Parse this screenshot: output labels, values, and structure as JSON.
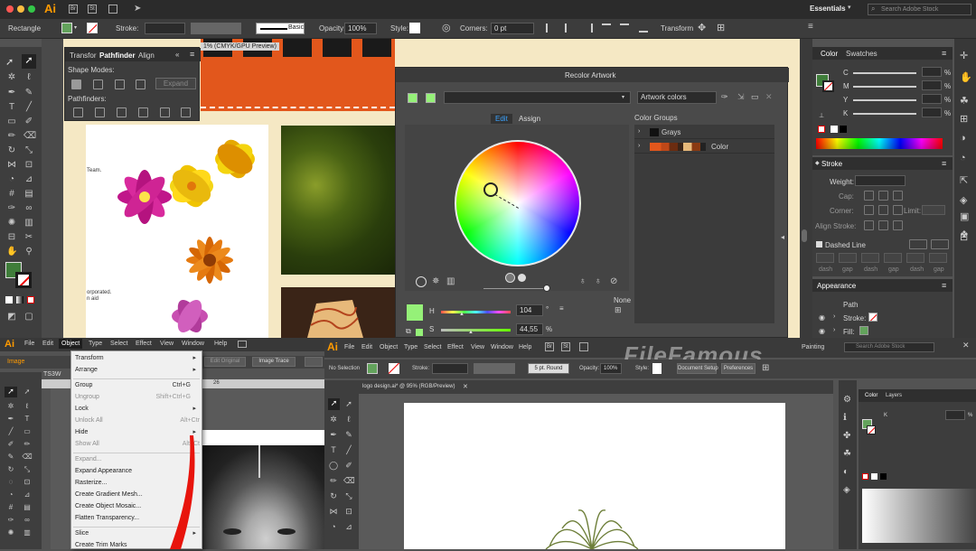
{
  "top_app": {
    "logo": "Ai",
    "workspace": "Essentials",
    "search_placeholder": "Search Adobe Stock",
    "control_bar": {
      "selection_label": "Rectangle",
      "stroke_label": "Stroke:",
      "brush_label": "Basic",
      "opacity_label": "Opacity:",
      "opacity_value": "100%",
      "style_label": "Style:",
      "corners_label": "Corners:",
      "corners_value": "0 pt",
      "transform_label": "Transform"
    },
    "doc_tab": "1% (CMYK/GPU Preview)",
    "pathfinder_panel": {
      "tabs": [
        "Transfor",
        "Pathfinder",
        "Align"
      ],
      "shape_modes_label": "Shape Modes:",
      "expand_label": "Expand",
      "pathfinders_label": "Pathfinders:"
    },
    "artboard_text": {
      "team": "Team.",
      "incorporated": "orporated.",
      "aid": "n aid"
    },
    "recolor": {
      "title": "Recolor Artwork",
      "artwork_colors": "Artwork colors",
      "tab_edit": "Edit",
      "tab_assign": "Assign",
      "color_groups_label": "Color Groups",
      "groups": [
        "Grays",
        "Color"
      ],
      "none_label": "None",
      "h_label": "H",
      "h_value": "104",
      "h_unit": "°",
      "s_label": "S",
      "s_value": "44,55",
      "s_unit": "%"
    },
    "color_panel": {
      "tabs": [
        "Color",
        "Swatches"
      ],
      "channels": [
        "C",
        "M",
        "Y",
        "K"
      ],
      "pct": "%"
    },
    "stroke_panel": {
      "title": "Stroke",
      "weight_label": "Weight:",
      "cap_label": "Cap:",
      "corner_label": "Corner:",
      "limit_label": "Limit:",
      "align_label": "Align Stroke:",
      "dashed_label": "Dashed Line",
      "dash_labels": [
        "dash",
        "gap",
        "dash",
        "gap",
        "dash",
        "gap"
      ]
    },
    "appearance_panel": {
      "title": "Appearance",
      "path_label": "Path",
      "stroke_label": "Stroke:",
      "fill_label": "Fill:"
    }
  },
  "bottom_left_app": {
    "logo": "Ai",
    "menu": [
      "File",
      "Edit",
      "Object",
      "Type",
      "Select",
      "Effect",
      "View",
      "Window",
      "Help"
    ],
    "image_label": "Image",
    "edit_original": "Edit Original",
    "image_trace": "Image Trace",
    "doc_tab": "TS3W",
    "ruler_mark": "26",
    "object_menu": [
      {
        "label": "Transform",
        "shortcut": "",
        "sub": true,
        "disabled": false
      },
      {
        "label": "Arrange",
        "shortcut": "",
        "sub": true,
        "disabled": false
      },
      {
        "label": "Group",
        "shortcut": "Ctrl+G",
        "sub": false,
        "disabled": false
      },
      {
        "label": "Ungroup",
        "shortcut": "Shift+Ctrl+G",
        "sub": false,
        "disabled": true
      },
      {
        "label": "Lock",
        "shortcut": "",
        "sub": true,
        "disabled": false
      },
      {
        "label": "Unlock All",
        "shortcut": "Alt+Ctr",
        "sub": false,
        "disabled": true
      },
      {
        "label": "Hide",
        "shortcut": "",
        "sub": true,
        "disabled": false
      },
      {
        "label": "Show All",
        "shortcut": "Alt+Ct",
        "sub": false,
        "disabled": true
      },
      {
        "label": "Expand...",
        "shortcut": "",
        "sub": false,
        "disabled": true
      },
      {
        "label": "Expand Appearance",
        "shortcut": "",
        "sub": false,
        "disabled": false
      },
      {
        "label": "Rasterize...",
        "shortcut": "",
        "sub": false,
        "disabled": false
      },
      {
        "label": "Create Gradient Mesh...",
        "shortcut": "",
        "sub": false,
        "disabled": false
      },
      {
        "label": "Create Object Mosaic...",
        "shortcut": "",
        "sub": false,
        "disabled": false
      },
      {
        "label": "Flatten Transparency...",
        "shortcut": "",
        "sub": false,
        "disabled": false
      },
      {
        "label": "Slice",
        "shortcut": "",
        "sub": true,
        "disabled": false
      },
      {
        "label": "Create Trim Marks",
        "shortcut": "",
        "sub": false,
        "disabled": false
      }
    ]
  },
  "bottom_right_app": {
    "logo": "Ai",
    "menu": [
      "File",
      "Edit",
      "Object",
      "Type",
      "Select",
      "Effect",
      "View",
      "Window",
      "Help"
    ],
    "workspace": "Painting",
    "search_placeholder": "Search Adobe Stock",
    "watermark": "FileFamous",
    "control": {
      "no_selection": "No Selection",
      "stroke_label": "Stroke:",
      "brush_value": "5 pt. Round",
      "opacity_label": "Opacity:",
      "opacity_value": "100%",
      "style_label": "Style:",
      "doc_setup": "Document Setup",
      "preferences": "Preferences"
    },
    "doc_tab": "logo design.ai* @ 95% (RGB/Preview)",
    "panel_tabs": [
      "Color",
      "Layers"
    ],
    "k_label": "K",
    "pct": "%"
  },
  "colors": {
    "accent_green": "#63a35c",
    "orange_banner": "#e2571c",
    "select_blue": "#2d8ceb"
  }
}
